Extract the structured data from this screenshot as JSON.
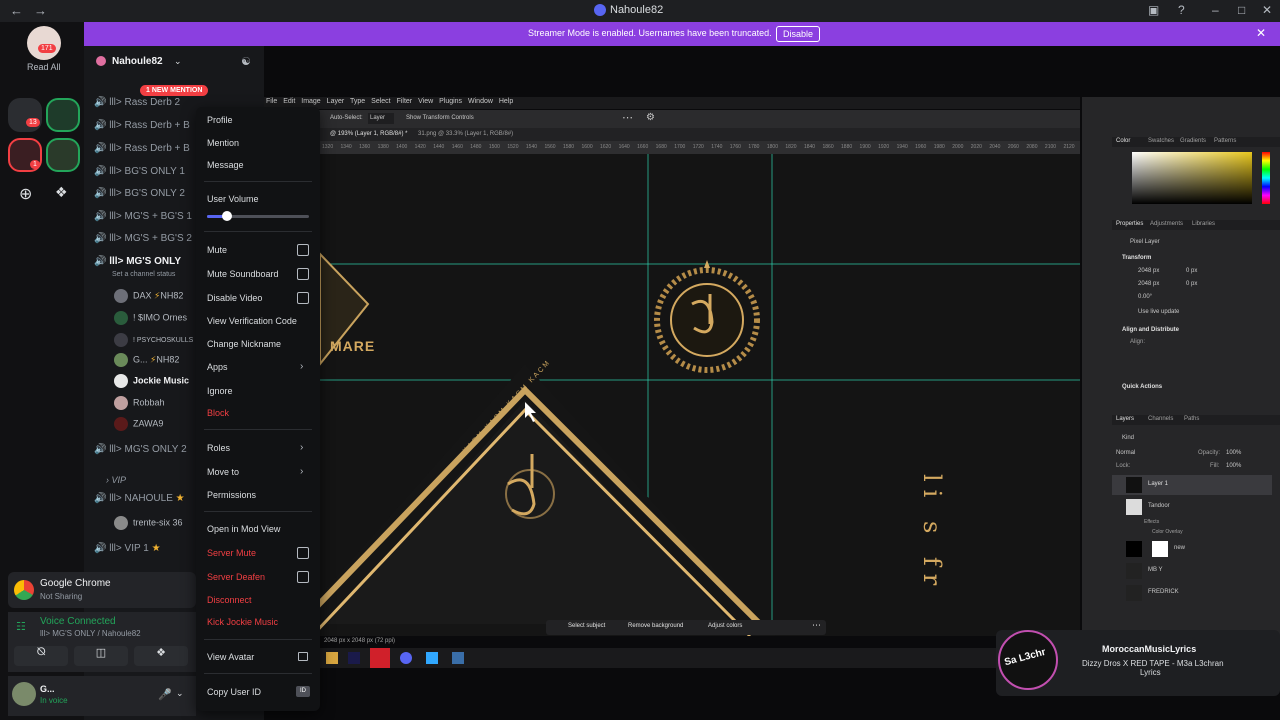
{
  "titlebar": {
    "title": "Nahoule82"
  },
  "banner": {
    "message": "Streamer Mode is enabled. Usernames have been truncated.",
    "disable_label": "Disable"
  },
  "rail": {
    "read_all": "Read All",
    "badge_171": "171",
    "badge_13": "13",
    "badge_1": "1"
  },
  "sidebar": {
    "server_name": "Nahoule82",
    "mention_badge": "1 NEW MENTION",
    "channels": [
      "lll> Rass Derb 2",
      "lll> Rass Derb + B",
      "lll> Rass Derb + B",
      "lll> BG'S ONLY 1",
      "lll> BG'S ONLY 2",
      "lll> MG'S + BG'S 1",
      "lll> MG'S + BG'S 2"
    ],
    "active_channel": "lll> MG'S ONLY",
    "channel_status": "Set a channel status",
    "members": [
      "DAX",
      "! $IMO Ornes",
      "! PSYCHOSKULLS",
      "G...",
      "Jockie Music",
      "Robbah",
      "ZAWA9"
    ],
    "member_tag": "NH82",
    "channel_mgs_only_2": "lll> MG'S ONLY 2",
    "category_vip": "VIP",
    "channel_nahoule": "lll> NAHOULE",
    "member_trente": "trente-six 36",
    "channel_vip1": "lll> VIP 1"
  },
  "chrome": {
    "title": "Google Chrome",
    "status": "Not Sharing"
  },
  "voice": {
    "status": "Voice Connected",
    "channel": "lll> MG'S ONLY / Nahoule82"
  },
  "user": {
    "name": "G...",
    "status": "In voice"
  },
  "context_menu": {
    "profile": "Profile",
    "mention": "Mention",
    "message": "Message",
    "user_volume": "User Volume",
    "volume_level": 0.2,
    "mute": "Mute",
    "mute_soundboard": "Mute Soundboard",
    "disable_video": "Disable Video",
    "view_verification": "View Verification Code",
    "change_nickname": "Change Nickname",
    "apps": "Apps",
    "ignore": "Ignore",
    "block": "Block",
    "roles": "Roles",
    "move_to": "Move to",
    "permissions": "Permissions",
    "open_mod_view": "Open in Mod View",
    "server_mute": "Server Mute",
    "server_deafen": "Server Deafen",
    "disconnect": "Disconnect",
    "kick": "Kick Jockie Music",
    "view_avatar": "View Avatar",
    "copy_user_id": "Copy User ID",
    "id_badge": "ID"
  },
  "photoshop": {
    "menu": [
      "File",
      "Edit",
      "Image",
      "Layer",
      "Type",
      "Select",
      "Filter",
      "View",
      "Plugins",
      "Window",
      "Help"
    ],
    "auto_select": "Auto-Select:",
    "layer_dropdown": "Layer",
    "show_transform": "Show Transform Controls",
    "tab1": "@ 193% (Layer 1, RGB/8#) *",
    "tab2": "31.png @ 33.3% (Layer 1, RGB/8#)",
    "panel_tabs": [
      "Color",
      "Swatches",
      "Gradients",
      "Patterns"
    ],
    "props_tabs": [
      "Properties",
      "Adjustments",
      "Libraries"
    ],
    "pixel_layer": "Pixel Layer",
    "transform": "Transform",
    "width": "2048 px",
    "height": "2048 px",
    "x": "0 px",
    "y": "0 px",
    "angle": "0.00°",
    "use_live": "Use live update",
    "align": "Align and Distribute",
    "align_label": "Align:",
    "quick_actions": "Quick Actions",
    "layers_tabs": [
      "Layers",
      "Channels",
      "Paths"
    ],
    "kind": "Kind",
    "blend": "Normal",
    "opacity_label": "Opacity:",
    "opacity": "100%",
    "lock_label": "Lock:",
    "fill_label": "Fill:",
    "fill": "100%",
    "layers": [
      "Layer 1",
      "Tandoor",
      "Effects",
      "Color Overlay",
      "new",
      "MB Y",
      "FREDRICK"
    ],
    "doc_info": "2048 px x 2048 px (72 ppi)",
    "select_subject": "Select subject",
    "remove_bg": "Remove background",
    "adjust_colors": "Adjust colors",
    "ruler_ticks": [
      "1320",
      "1340",
      "1360",
      "1380",
      "1400",
      "1420",
      "1440",
      "1460",
      "1480",
      "1500",
      "1520",
      "1540",
      "1560",
      "1580",
      "1600",
      "1620",
      "1640",
      "1660",
      "1680",
      "1700",
      "1720",
      "1740",
      "1760",
      "1780",
      "1800",
      "1820",
      "1840",
      "1860",
      "1880",
      "1900",
      "1920",
      "1940",
      "1960",
      "1980",
      "2000",
      "2020",
      "2040",
      "2060",
      "2080",
      "2100",
      "2120"
    ],
    "canvas_text_mare": "MARE",
    "canvas_vertical_text": "li s fr",
    "border_text": "KACM KACM KACM KACM"
  },
  "notification": {
    "title": "MoroccanMusicLyrics",
    "line1": "Dizzy Dros X RED TAPE - M3a L3chran",
    "line2": "Lyrics",
    "logo_text": "Sa L3chr"
  },
  "colors": {
    "accent": "#8b3fe0",
    "green": "#23a55a",
    "red": "#f23f43",
    "gold": "#c9a35e"
  }
}
